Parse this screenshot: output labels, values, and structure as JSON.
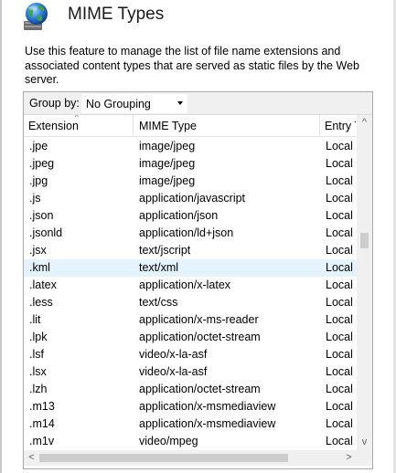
{
  "header": {
    "title": "MIME Types",
    "icon": "globe-icon"
  },
  "description": "Use this feature to manage the list of file name extensions and associated content types that are served as static files by the Web server.",
  "group_by": {
    "label": "Group by:",
    "selected": "No Grouping"
  },
  "columns": {
    "extension": "Extension",
    "mime_type": "MIME Type",
    "entry_type": "Entry T"
  },
  "rows": [
    {
      "ext": ".jpe",
      "mime": "image/jpeg",
      "entry": "Local"
    },
    {
      "ext": ".jpeg",
      "mime": "image/jpeg",
      "entry": "Local"
    },
    {
      "ext": ".jpg",
      "mime": "image/jpeg",
      "entry": "Local"
    },
    {
      "ext": ".js",
      "mime": "application/javascript",
      "entry": "Local"
    },
    {
      "ext": ".json",
      "mime": "application/json",
      "entry": "Local"
    },
    {
      "ext": ".jsonld",
      "mime": "application/ld+json",
      "entry": "Local"
    },
    {
      "ext": ".jsx",
      "mime": "text/jscript",
      "entry": "Local"
    },
    {
      "ext": ".kml",
      "mime": "text/xml",
      "entry": "Local",
      "selected": true
    },
    {
      "ext": ".latex",
      "mime": "application/x-latex",
      "entry": "Local"
    },
    {
      "ext": ".less",
      "mime": "text/css",
      "entry": "Local"
    },
    {
      "ext": ".lit",
      "mime": "application/x-ms-reader",
      "entry": "Local"
    },
    {
      "ext": ".lpk",
      "mime": "application/octet-stream",
      "entry": "Local"
    },
    {
      "ext": ".lsf",
      "mime": "video/x-la-asf",
      "entry": "Local"
    },
    {
      "ext": ".lsx",
      "mime": "video/x-la-asf",
      "entry": "Local"
    },
    {
      "ext": ".lzh",
      "mime": "application/octet-stream",
      "entry": "Local"
    },
    {
      "ext": ".m13",
      "mime": "application/x-msmediaview",
      "entry": "Local"
    },
    {
      "ext": ".m14",
      "mime": "application/x-msmediaview",
      "entry": "Local"
    },
    {
      "ext": ".m1v",
      "mime": "video/mpeg",
      "entry": "Local"
    }
  ],
  "colors": {
    "selected_row": "#e5f3ff",
    "scrollbar_track": "#f0f0f0",
    "scrollbar_thumb": "#cdcdcd",
    "panel_border": "#a9a9a9"
  }
}
